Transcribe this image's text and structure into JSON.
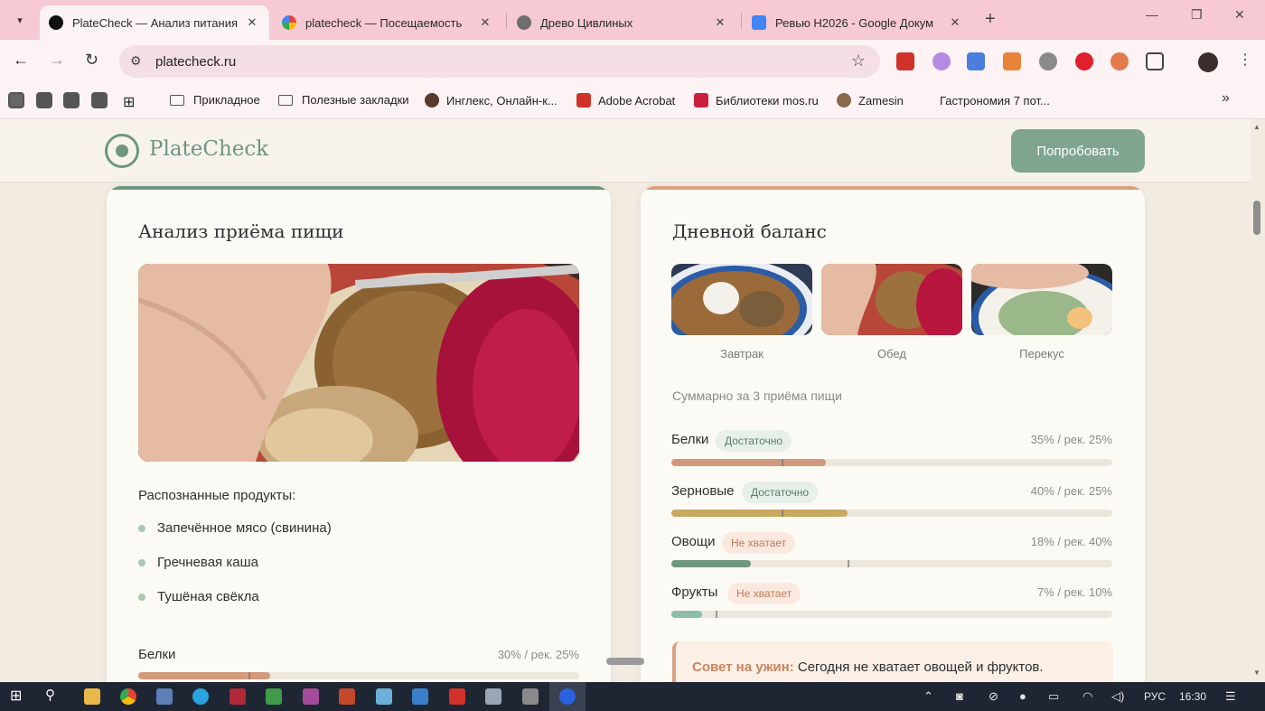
{
  "browser": {
    "tabs": [
      {
        "title": "PlateCheck — Анализ питания",
        "active": true
      },
      {
        "title": "platecheck — Посещаемость",
        "active": false
      },
      {
        "title": "Древо Цивлиных",
        "active": false
      },
      {
        "title": "Ревью H2026 - Google Докум",
        "active": false
      }
    ],
    "url": "platecheck.ru",
    "bookmarks": [
      "Прикладное",
      "Полезные закладки",
      "Инглекс, Онлайн-к...",
      "Adobe Acrobat",
      "Библиотеки mos.ru",
      "Zamesin",
      "Гастрономия 7 пот..."
    ]
  },
  "site": {
    "logo": "PlateCheck",
    "cta": "Попробовать"
  },
  "meal_card": {
    "title": "Анализ приёма пищи",
    "recognized_label": "Распознанные продукты:",
    "foods": [
      "Запечённое мясо (свинина)",
      "Гречневая каша",
      "Тушёная свёкла"
    ],
    "nutrients": [
      {
        "label": "Белки",
        "value_text": "30% / рек. 25%",
        "value": 30,
        "recommended": 25,
        "color": "#d19a7c"
      }
    ]
  },
  "balance_card": {
    "title": "Дневной баланс",
    "meals": [
      "Завтрак",
      "Обед",
      "Перекус"
    ],
    "summary": "Суммарно за 3 приёма пищи",
    "nutrients": [
      {
        "label": "Белки",
        "badge": "Достаточно",
        "status": "ok",
        "value_text": "35% / рек. 25%",
        "value": 35,
        "recommended": 25,
        "color": "#d19a7c"
      },
      {
        "label": "Зерновые",
        "badge": "Достаточно",
        "status": "ok",
        "value_text": "40% / рек. 25%",
        "value": 40,
        "recommended": 25,
        "color": "#c9a85f"
      },
      {
        "label": "Овощи",
        "badge": "Не хватает",
        "status": "low",
        "value_text": "18% / рек. 40%",
        "value": 18,
        "recommended": 40,
        "color": "#6e9680"
      },
      {
        "label": "Фрукты",
        "badge": "Не хватает",
        "status": "low",
        "value_text": "7% / рек. 10%",
        "value": 7,
        "recommended": 10,
        "color": "#8cbfa3"
      }
    ],
    "tip_head": "Совет на ужин:",
    "tip_text": "Сегодня не хватает овощей и фруктов."
  },
  "taskbar": {
    "lang": "РУС",
    "time": "16:30"
  }
}
